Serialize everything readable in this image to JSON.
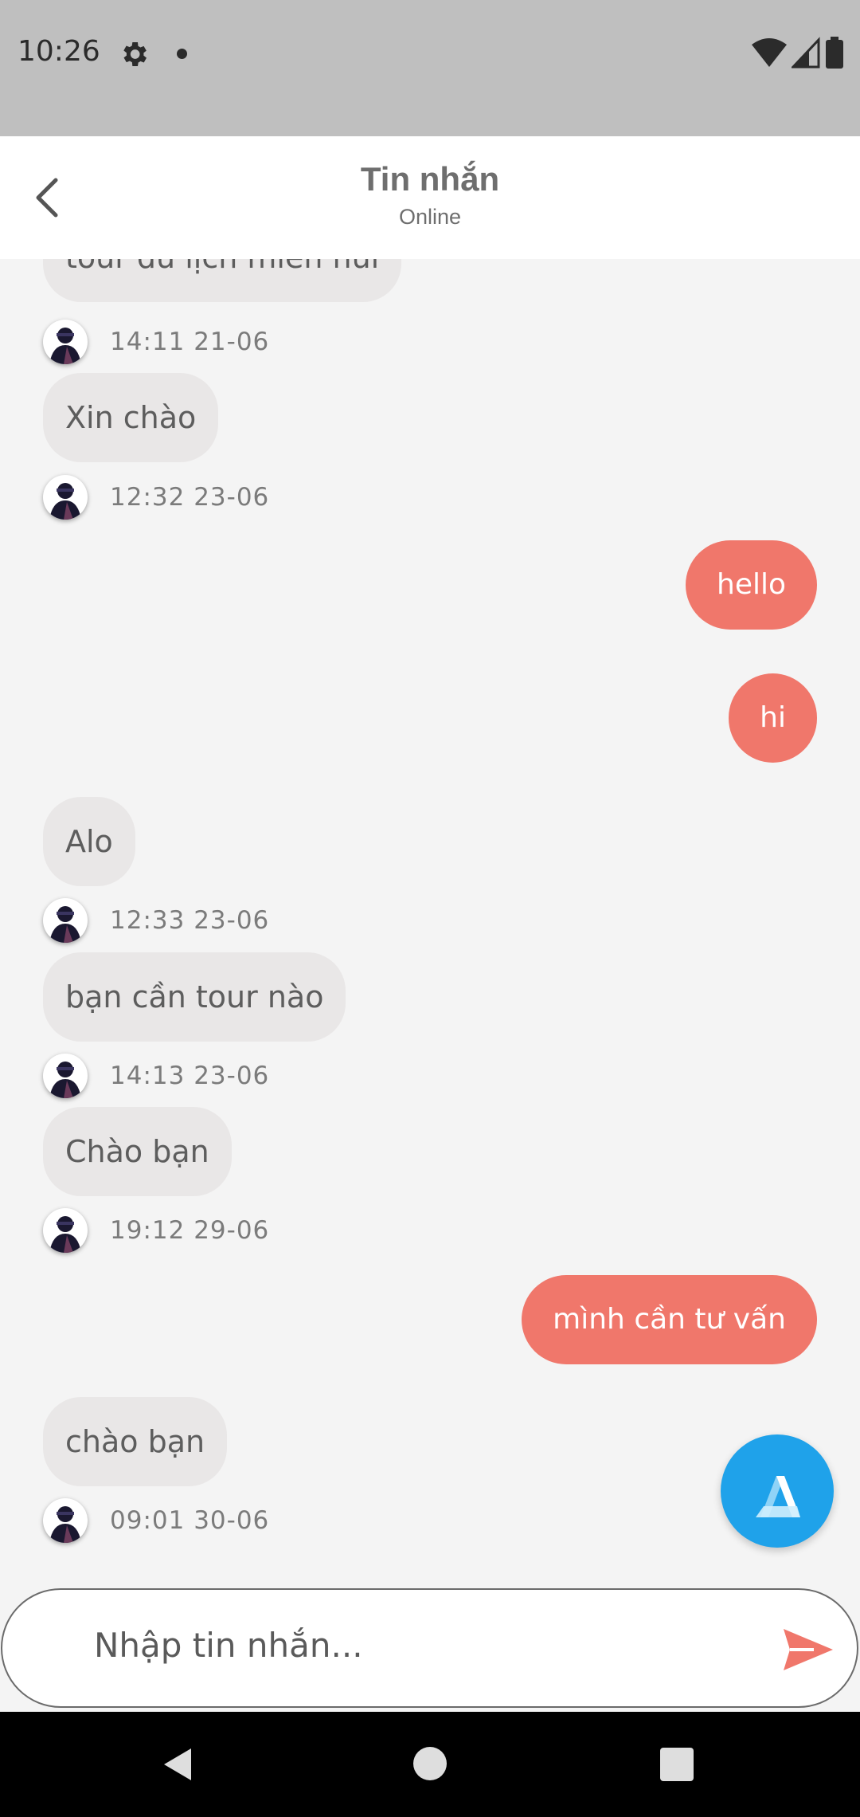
{
  "status_bar": {
    "time": "10:26"
  },
  "header": {
    "title": "Tin nhắn",
    "subtitle": "Online"
  },
  "messages": [
    {
      "text": "tour du lịch miền núi"
    },
    {
      "meta_time": "14:11 21-06"
    },
    {
      "text": "Xin chào"
    },
    {
      "meta_time": "12:32 23-06"
    },
    {
      "text": "hello"
    },
    {
      "text": "hi"
    },
    {
      "text": "Alo"
    },
    {
      "meta_time": "12:33 23-06"
    },
    {
      "text": "bạn cần tour nào"
    },
    {
      "meta_time": "14:13 23-06"
    },
    {
      "text": "Chào bạn"
    },
    {
      "meta_time": "19:12 29-06"
    },
    {
      "text": "mình cần tư vấn"
    },
    {
      "text": "chào bạn"
    },
    {
      "meta_time": "09:01 30-06"
    }
  ],
  "input": {
    "placeholder": "Nhập tin nhắn..."
  },
  "colors": {
    "outgoing": "#f0776b",
    "incoming": "#e9e7e7",
    "fab": "#1fa2ea",
    "background": "#f4f4f4"
  }
}
